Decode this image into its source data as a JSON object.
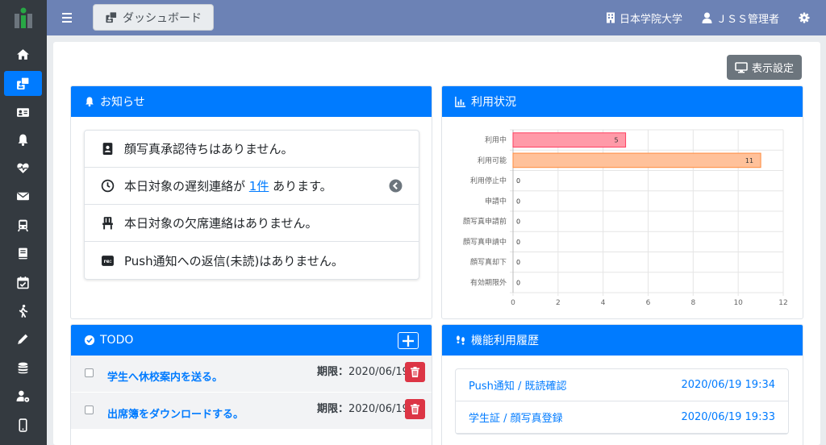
{
  "header": {
    "dashboard_label": "ダッシュボード",
    "school": "日本学院大学",
    "user": "ＪＳＳ管理者"
  },
  "sidebar": {
    "items": [
      "home-icon",
      "id-card-icon",
      "address-card-icon",
      "bell-icon",
      "heartbeat-icon",
      "envelope-icon",
      "train-icon",
      "book-icon",
      "calendar-check-icon",
      "walking-icon",
      "pencil-icon",
      "database-icon",
      "user-cog-icon",
      "mobile-icon"
    ]
  },
  "main": {
    "display_settings_label": "表示設定"
  },
  "notices": {
    "title": "お知らせ",
    "items": [
      {
        "text": "顔写真承認待ちはありません。"
      },
      {
        "pre": "本日対象の遅刻連絡が ",
        "link": "1件",
        "post": " あります。"
      },
      {
        "text": "本日対象の欠席連絡はありません。"
      },
      {
        "text": "Push通知への返信(未読)はありません。"
      }
    ]
  },
  "usage": {
    "title": "利用状況"
  },
  "chart_data": {
    "type": "bar",
    "orientation": "horizontal",
    "categories": [
      "利用中",
      "利用可能",
      "利用停止中",
      "申請中",
      "顔写真申請前",
      "顔写真申請中",
      "顔写真却下",
      "有効期限外"
    ],
    "values": [
      5,
      11,
      0,
      0,
      0,
      0,
      0,
      0
    ],
    "colors": [
      "#ff9aa8",
      "#ffc19a",
      "#9ad0f5",
      "#9ad0f5",
      "#9ad0f5",
      "#9ad0f5",
      "#9ad0f5",
      "#9ad0f5"
    ],
    "xlim": [
      0,
      12
    ],
    "xticks": [
      0,
      2,
      4,
      6,
      8,
      10,
      12
    ],
    "grid": true
  },
  "todo": {
    "title": "TODO",
    "items": [
      {
        "task": "学生へ休校案内を送る。",
        "due_label": "期限：",
        "due": "2020/06/19"
      },
      {
        "task": "出席簿をダウンロードする。",
        "due_label": "期限：",
        "due": "2020/06/19"
      }
    ]
  },
  "history": {
    "title": "機能利用履歴",
    "items": [
      {
        "label": "Push通知 / 既読確認",
        "time": "2020/06/19 19:34"
      },
      {
        "label": "学生証 / 顔写真登録",
        "time": "2020/06/19 19:33"
      }
    ]
  },
  "colors": {
    "primary": "#007bff",
    "sidebar": "#343a40",
    "header": "#6c82b5",
    "danger": "#dc3545",
    "secondary": "#6c757d"
  }
}
